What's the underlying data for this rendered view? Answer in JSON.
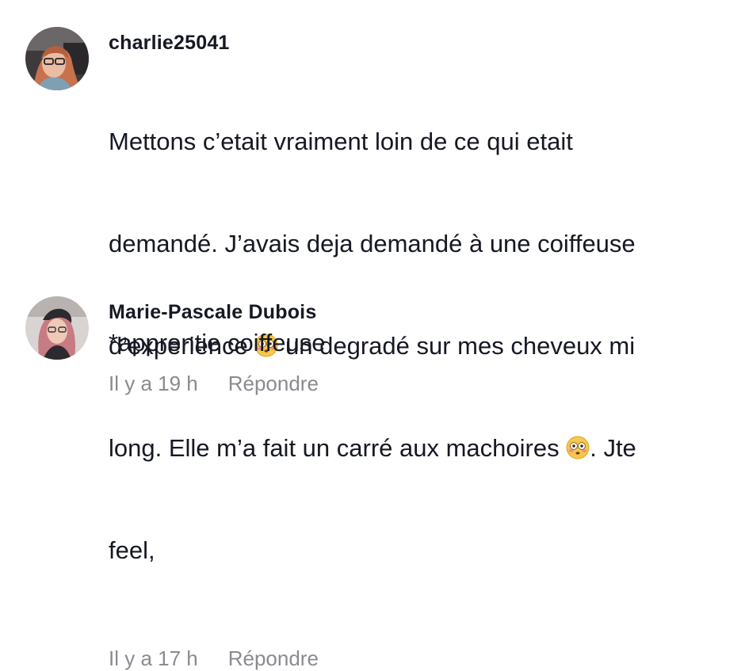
{
  "comments": [
    {
      "username": "charlie25041",
      "text_line1": "Mettons c’etait vraiment loin de ce qui etait",
      "text_line2": "demandé. J’avais deja demandé à une coiffeuse",
      "text_line3a": "d’experience ",
      "text_line3b": " un degradé sur mes cheveux mi",
      "text_line4a": "long. Elle m’a fait un carré aux machoires ",
      "text_line4b": ". Jte",
      "text_line5": "feel,",
      "emoji": "flushed-face-emoji",
      "time": "Il y a 17 h",
      "reply_label": "Répondre"
    },
    {
      "username": "Marie-Pascale Dubois",
      "text": "*apprentie coiffeuse",
      "time": "Il y a 19 h",
      "reply_label": "Répondre"
    }
  ],
  "colors": {
    "text": "#161823",
    "meta": "#8a8b91",
    "background": "#ffffff"
  }
}
